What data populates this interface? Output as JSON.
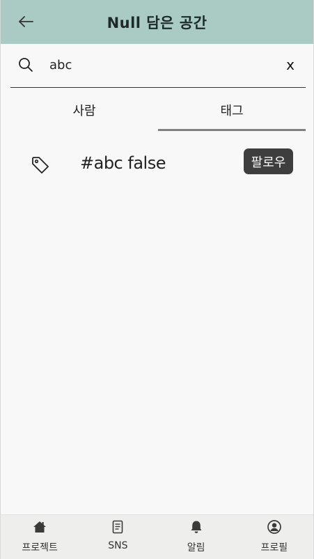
{
  "header": {
    "back_icon": "arrow-left-icon",
    "title": "Null 담은 공간"
  },
  "search": {
    "icon": "search-icon",
    "value": "abc",
    "placeholder": "",
    "clear_label": "x"
  },
  "tabs": [
    {
      "label": "사람",
      "active": false
    },
    {
      "label": "태그",
      "active": true
    }
  ],
  "results": [
    {
      "icon": "tag-icon",
      "text": "#abc false",
      "follow_label": "팔로우"
    }
  ],
  "bottom_nav": [
    {
      "label": "프로젝트",
      "icon": "home-icon"
    },
    {
      "label": "SNS",
      "icon": "document-icon"
    },
    {
      "label": "알림",
      "icon": "bell-icon"
    },
    {
      "label": "프로필",
      "icon": "user-circle-icon"
    }
  ],
  "colors": {
    "header_bg": "#a9cbc3",
    "page_bg": "#f8f8f8",
    "follow_button_bg": "#3e3e3e",
    "active_tab_indicator": "#808080",
    "bottom_nav_bg": "#eeeeec"
  }
}
